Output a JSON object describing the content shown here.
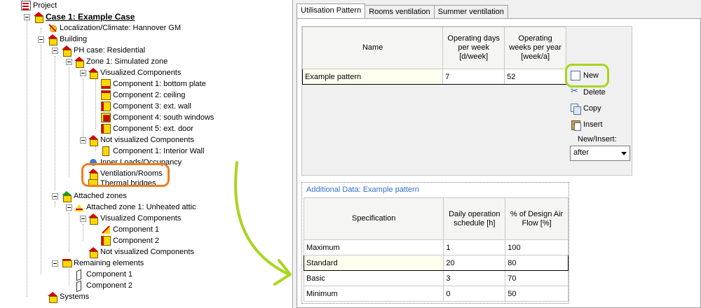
{
  "tree": {
    "items": [
      {
        "label": "Project",
        "bold": false
      },
      {
        "label": "Case 1: Example Case",
        "bold": true
      },
      {
        "label": "Localization/Climate: Hannover GM"
      },
      {
        "label": "Building"
      },
      {
        "label": "PH case: Residential"
      },
      {
        "label": "Zone 1: Simulated zone"
      },
      {
        "label": "Visualized Components"
      },
      {
        "label": "Component 1: bottom plate"
      },
      {
        "label": "Component 2: ceiling"
      },
      {
        "label": "Component 3: ext. wall"
      },
      {
        "label": "Component 4: south windows"
      },
      {
        "label": "Component 5: ext. door"
      },
      {
        "label": "Not visualized Components"
      },
      {
        "label": "Component 1: Interior Wall"
      },
      {
        "label": "Inner Loads/Occupancy"
      },
      {
        "label": "Ventilation/Rooms"
      },
      {
        "label": "Thermal bridges"
      },
      {
        "label": "Attached zones"
      },
      {
        "label": "Attached zone 1: Unheated attic"
      },
      {
        "label": "Visualized Components"
      },
      {
        "label": "Component 1"
      },
      {
        "label": "Component 2"
      },
      {
        "label": "Not visualized Components"
      },
      {
        "label": "Remaining elements"
      },
      {
        "label": "Component 1"
      },
      {
        "label": "Component 2"
      },
      {
        "label": "Systems"
      }
    ]
  },
  "tabs": [
    {
      "label": "Utilisation Pattern",
      "active": true
    },
    {
      "label": "Rooms ventilation",
      "active": false
    },
    {
      "label": "Summer ventilation",
      "active": false
    }
  ],
  "patterns": {
    "headers": [
      "Name",
      "Operating days per week [d/week]",
      "Operating weeks per year [week/a]"
    ],
    "rows": [
      {
        "name": "Example pattern",
        "days": "7",
        "weeks": "52"
      }
    ]
  },
  "actions": {
    "new_label": "New",
    "delete_label": "Delete",
    "copy_label": "Copy",
    "insert_label": "Insert",
    "new_insert_label": "New/Insert:",
    "new_insert_value": "after"
  },
  "additional": {
    "title": "Additional Data: Example pattern",
    "headers": [
      "Specification",
      "Daily operation schedule [h]",
      "% of Design Air Flow [%]"
    ],
    "rows": [
      {
        "spec": "Maximum",
        "hours": "1",
        "flow": "100"
      },
      {
        "spec": "Standard",
        "hours": "20",
        "flow": "80"
      },
      {
        "spec": "Basic",
        "hours": "3",
        "flow": "70"
      },
      {
        "spec": "Minimum",
        "hours": "0",
        "flow": "50"
      }
    ]
  },
  "annotation_colors": {
    "orange": "#f07d1f",
    "green": "#a8d51f"
  }
}
